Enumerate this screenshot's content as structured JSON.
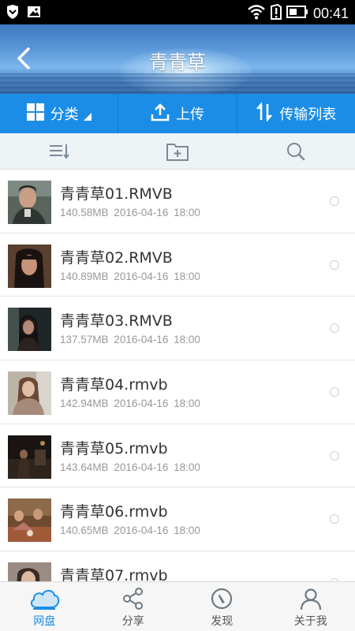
{
  "status_bar": {
    "time": "00:41"
  },
  "header": {
    "title": "青青草"
  },
  "action_bar": {
    "category_label": "分类",
    "upload_label": "上传",
    "transfer_label": "传输列表"
  },
  "files": [
    {
      "name": "青青草01.RMVB",
      "size": "140.58MB",
      "date": "2016-04-16",
      "time": "18:00"
    },
    {
      "name": "青青草02.RMVB",
      "size": "140.89MB",
      "date": "2016-04-16",
      "time": "18:00"
    },
    {
      "name": "青青草03.RMVB",
      "size": "137.57MB",
      "date": "2016-04-16",
      "time": "18:00"
    },
    {
      "name": "青青草04.rmvb",
      "size": "142.94MB",
      "date": "2016-04-16",
      "time": "18:00"
    },
    {
      "name": "青青草05.rmvb",
      "size": "143.64MB",
      "date": "2016-04-16",
      "time": "18:00"
    },
    {
      "name": "青青草06.rmvb",
      "size": "140.65MB",
      "date": "2016-04-16",
      "time": "18:00"
    },
    {
      "name": "青青草07.rmvb",
      "size": "",
      "date": "",
      "time": ""
    }
  ],
  "bottom_nav": {
    "items": [
      {
        "label": "网盘",
        "icon": "cloud-icon"
      },
      {
        "label": "分享",
        "icon": "share-icon"
      },
      {
        "label": "发现",
        "icon": "compass-icon"
      },
      {
        "label": "关于我",
        "icon": "user-icon"
      }
    ]
  },
  "colors": {
    "accent": "#1b8de6",
    "toolbar_bg": "#eef3f6",
    "status_bar": "#000000"
  }
}
